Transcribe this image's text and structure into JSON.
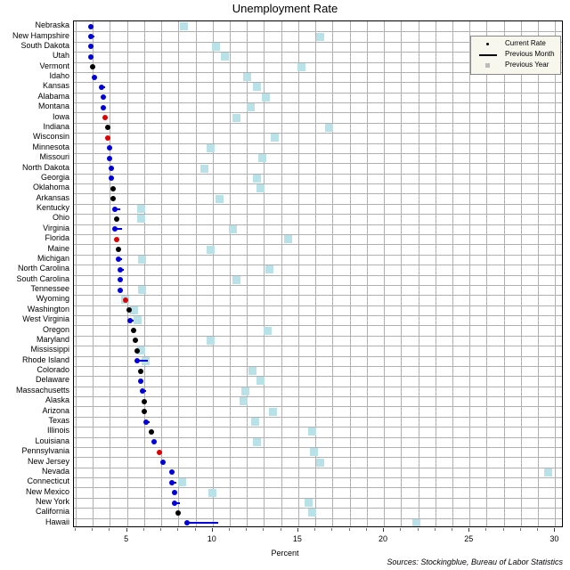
{
  "chart": {
    "title": "Unemployment Rate",
    "xlabel": "Percent",
    "source": "Sources: Stockingblue, Bureau of Labor Statistics"
  },
  "legend": {
    "items": [
      {
        "label": "Current Rate",
        "icon": "dot-marker",
        "color": "#000000"
      },
      {
        "label": "Previous Month",
        "icon": "line-marker",
        "color": "#000000"
      },
      {
        "label": "Previous Year",
        "icon": "square-marker",
        "color": "#bbbbbb"
      }
    ]
  },
  "axis": {
    "xticks": [
      5,
      10,
      15,
      20,
      25,
      30
    ],
    "xticklabels": [
      "5",
      "10",
      "15",
      "20",
      "25",
      "30"
    ],
    "xlim": [
      1.9,
      30.5
    ],
    "grid": true,
    "gridstep": 1
  },
  "chart_data": {
    "type": "scatter",
    "title": "Unemployment Rate",
    "xlabel": "Percent",
    "ylabel": "",
    "xlim": [
      1.9,
      30.5
    ],
    "grid": true,
    "legend_position": "top-right",
    "series": [
      {
        "name": "Current Rate",
        "marker": "dot"
      },
      {
        "name": "Previous Month",
        "marker": "line"
      },
      {
        "name": "Previous Year",
        "marker": "square"
      }
    ],
    "color_rules": {
      "lower_than_previous": "#0000dd",
      "equal_to_previous": "#000000",
      "higher_than_previous": "#dd0000"
    },
    "categories": [
      "Nebraska",
      "New Hampshire",
      "South Dakota",
      "Utah",
      "Vermont",
      "Idaho",
      "Kansas",
      "Alabama",
      "Montana",
      "Iowa",
      "Indiana",
      "Wisconsin",
      "Minnesota",
      "Missouri",
      "North Dakota",
      "Georgia",
      "Oklahoma",
      "Arkansas",
      "Kentucky",
      "Ohio",
      "Virginia",
      "Florida",
      "Maine",
      "Michigan",
      "North Carolina",
      "South Carolina",
      "Tennessee",
      "Wyoming",
      "Washington",
      "West Virginia",
      "Oregon",
      "Maryland",
      "Mississippi",
      "Rhode Island",
      "Colorado",
      "Delaware",
      "Massachusetts",
      "Alaska",
      "Arizona",
      "Texas",
      "Illinois",
      "Louisiana",
      "Pennsylvania",
      "New Jersey",
      "Nevada",
      "Connecticut",
      "New Mexico",
      "New York",
      "California",
      "Hawaii"
    ],
    "rows": [
      {
        "state": "Nebraska",
        "current": 2.9,
        "previous_month": 3.0,
        "previous_year": 8.3,
        "color": "#0000dd"
      },
      {
        "state": "New Hampshire",
        "current": 2.9,
        "previous_month": 3.1,
        "previous_year": 16.3,
        "color": "#0000dd"
      },
      {
        "state": "South Dakota",
        "current": 2.9,
        "previous_month": 3.0,
        "previous_year": 10.2,
        "color": "#0000dd"
      },
      {
        "state": "Utah",
        "current": 2.9,
        "previous_month": 3.0,
        "previous_year": 10.7,
        "color": "#0000dd"
      },
      {
        "state": "Vermont",
        "current": 3.0,
        "previous_month": 3.0,
        "previous_year": 15.2,
        "color": "#000000"
      },
      {
        "state": "Idaho",
        "current": 3.1,
        "previous_month": 3.2,
        "previous_year": 12.0,
        "color": "#0000dd"
      },
      {
        "state": "Kansas",
        "current": 3.5,
        "previous_month": 3.7,
        "previous_year": 12.6,
        "color": "#0000dd"
      },
      {
        "state": "Alabama",
        "current": 3.6,
        "previous_month": 3.7,
        "previous_year": 13.1,
        "color": "#0000dd"
      },
      {
        "state": "Montana",
        "current": 3.6,
        "previous_month": 3.7,
        "previous_year": 12.2,
        "color": "#0000dd"
      },
      {
        "state": "Iowa",
        "current": 3.7,
        "previous_month": 3.6,
        "previous_year": 11.4,
        "color": "#dd0000"
      },
      {
        "state": "Indiana",
        "current": 3.9,
        "previous_month": 3.9,
        "previous_year": 16.8,
        "color": "#000000"
      },
      {
        "state": "Wisconsin",
        "current": 3.9,
        "previous_month": 3.8,
        "previous_year": 13.6,
        "color": "#dd0000"
      },
      {
        "state": "Minnesota",
        "current": 4.0,
        "previous_month": 4.1,
        "previous_year": 9.9,
        "color": "#0000dd"
      },
      {
        "state": "Missouri",
        "current": 4.0,
        "previous_month": 4.1,
        "previous_year": 12.9,
        "color": "#0000dd"
      },
      {
        "state": "North Dakota",
        "current": 4.1,
        "previous_month": 4.2,
        "previous_year": 9.5,
        "color": "#0000dd"
      },
      {
        "state": "Georgia",
        "current": 4.1,
        "previous_month": 4.2,
        "previous_year": 12.6,
        "color": "#0000dd"
      },
      {
        "state": "Oklahoma",
        "current": 4.2,
        "previous_month": 4.2,
        "previous_year": 12.8,
        "color": "#000000"
      },
      {
        "state": "Arkansas",
        "current": 4.2,
        "previous_month": 4.2,
        "previous_year": 10.4,
        "color": "#000000"
      },
      {
        "state": "Kentucky",
        "current": 4.3,
        "previous_month": 4.6,
        "previous_year": 5.8,
        "color": "#0000dd"
      },
      {
        "state": "Ohio",
        "current": 4.4,
        "previous_month": 4.4,
        "previous_year": 5.8,
        "color": "#000000"
      },
      {
        "state": "Virginia",
        "current": 4.3,
        "previous_month": 4.7,
        "previous_year": 11.2,
        "color": "#0000dd"
      },
      {
        "state": "Florida",
        "current": 4.4,
        "previous_month": 4.3,
        "previous_year": 14.4,
        "color": "#dd0000"
      },
      {
        "state": "Maine",
        "current": 4.5,
        "previous_month": 4.5,
        "previous_year": 9.9,
        "color": "#000000"
      },
      {
        "state": "Michigan",
        "current": 4.5,
        "previous_month": 4.7,
        "previous_year": 5.9,
        "color": "#0000dd"
      },
      {
        "state": "North Carolina",
        "current": 4.6,
        "previous_month": 4.8,
        "previous_year": 13.3,
        "color": "#0000dd"
      },
      {
        "state": "South Carolina",
        "current": 4.6,
        "previous_month": 4.7,
        "previous_year": 11.4,
        "color": "#0000dd"
      },
      {
        "state": "Tennessee",
        "current": 4.6,
        "previous_month": 4.7,
        "previous_year": 5.9,
        "color": "#0000dd"
      },
      {
        "state": "Wyoming",
        "current": 4.9,
        "previous_month": 4.8,
        "previous_year": 4.9,
        "color": "#dd0000"
      },
      {
        "state": "Washington",
        "current": 5.1,
        "previous_month": 5.1,
        "previous_year": 5.4,
        "color": "#000000"
      },
      {
        "state": "West Virginia",
        "current": 5.2,
        "previous_month": 5.4,
        "previous_year": 5.6,
        "color": "#0000dd"
      },
      {
        "state": "Oregon",
        "current": 5.4,
        "previous_month": 5.4,
        "previous_year": 13.2,
        "color": "#000000"
      },
      {
        "state": "Maryland",
        "current": 5.5,
        "previous_month": 5.5,
        "previous_year": 9.9,
        "color": "#000000"
      },
      {
        "state": "Mississippi",
        "current": 5.6,
        "previous_month": 5.6,
        "previous_year": 5.8,
        "color": "#000000"
      },
      {
        "state": "Rhode Island",
        "current": 5.6,
        "previous_month": 6.2,
        "previous_year": 6.1,
        "color": "#0000dd"
      },
      {
        "state": "Colorado",
        "current": 5.8,
        "previous_month": 5.8,
        "previous_year": 12.3,
        "color": "#000000"
      },
      {
        "state": "Delaware",
        "current": 5.8,
        "previous_month": 5.9,
        "previous_year": 12.8,
        "color": "#0000dd"
      },
      {
        "state": "Massachusetts",
        "current": 5.9,
        "previous_month": 6.1,
        "previous_year": 11.9,
        "color": "#0000dd"
      },
      {
        "state": "Alaska",
        "current": 6.0,
        "previous_month": 6.0,
        "previous_year": 11.8,
        "color": "#000000"
      },
      {
        "state": "Arizona",
        "current": 6.0,
        "previous_month": 6.0,
        "previous_year": 13.5,
        "color": "#000000"
      },
      {
        "state": "Texas",
        "current": 6.1,
        "previous_month": 6.3,
        "previous_year": 12.5,
        "color": "#0000dd"
      },
      {
        "state": "Illinois",
        "current": 6.4,
        "previous_month": 6.4,
        "previous_year": 15.8,
        "color": "#000000"
      },
      {
        "state": "Louisiana",
        "current": 6.6,
        "previous_month": 6.7,
        "previous_year": 12.6,
        "color": "#0000dd"
      },
      {
        "state": "Pennsylvania",
        "current": 6.9,
        "previous_month": 6.8,
        "previous_year": 15.9,
        "color": "#dd0000"
      },
      {
        "state": "New Jersey",
        "current": 7.1,
        "previous_month": 7.2,
        "previous_year": 16.3,
        "color": "#0000dd"
      },
      {
        "state": "Nevada",
        "current": 7.6,
        "previous_month": 7.8,
        "previous_year": 29.6,
        "color": "#0000dd"
      },
      {
        "state": "Connecticut",
        "current": 7.6,
        "previous_month": 7.9,
        "previous_year": 8.2,
        "color": "#0000dd"
      },
      {
        "state": "New Mexico",
        "current": 7.8,
        "previous_month": 7.9,
        "previous_year": 10.0,
        "color": "#0000dd"
      },
      {
        "state": "New York",
        "current": 7.8,
        "previous_month": 8.1,
        "previous_year": 15.6,
        "color": "#0000dd"
      },
      {
        "state": "California",
        "current": 8.0,
        "previous_month": 8.0,
        "previous_year": 15.8,
        "color": "#000000"
      },
      {
        "state": "Hawaii",
        "current": 8.5,
        "previous_month": 10.3,
        "previous_year": 21.9,
        "color": "#0000dd"
      }
    ]
  }
}
